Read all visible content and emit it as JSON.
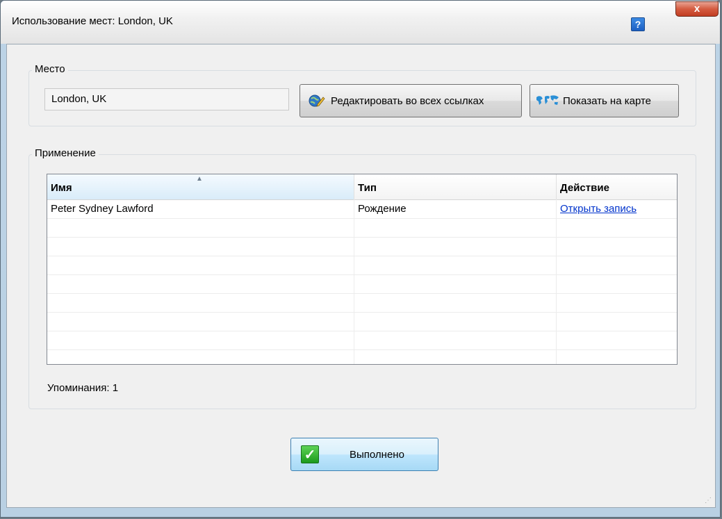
{
  "window": {
    "title": "Использование мест: London, UK",
    "help_label": "?",
    "close_label": "x"
  },
  "place_group": {
    "label": "Место",
    "place_value": "London, UK",
    "edit_all_button": "Редактировать во всех ссылках",
    "show_map_button": "Показать на карте"
  },
  "usage_group": {
    "label": "Применение",
    "columns": [
      "Имя",
      "Тип",
      "Действие"
    ],
    "rows": [
      {
        "name": "Peter Sydney Lawford",
        "type": "Рождение",
        "action": "Открыть запись"
      }
    ],
    "mentions_label": "Упоминания: 1"
  },
  "footer": {
    "done_button": "Выполнено"
  },
  "colors": {
    "link": "#0033cc",
    "accent": "#3c7fb1",
    "check": "#1c9a1c"
  }
}
